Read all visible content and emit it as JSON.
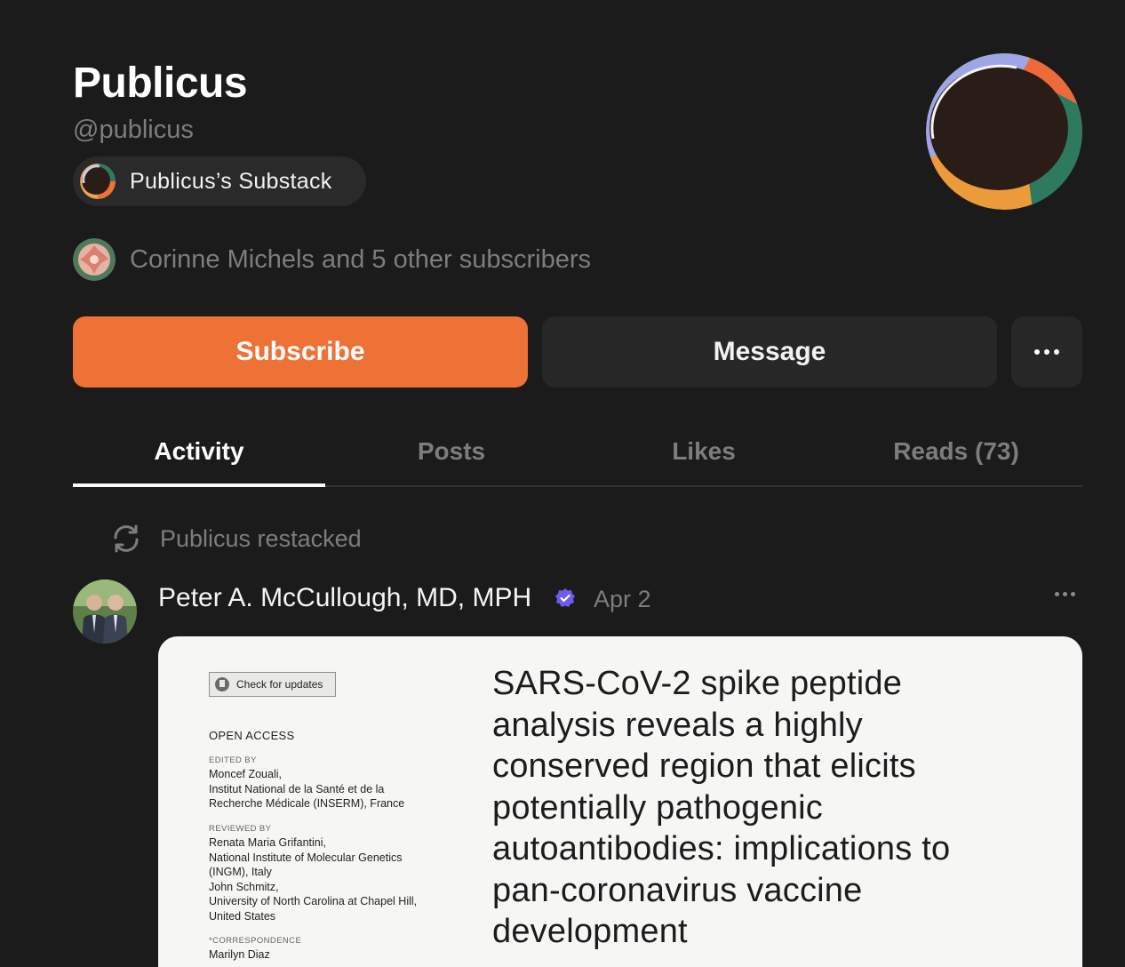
{
  "profile": {
    "name": "Publicus",
    "handle": "@publicus",
    "publication_label": "Publicus’s Substack",
    "subscribers_text": "Corinne Michels and 5 other subscribers"
  },
  "actions": {
    "subscribe_label": "Subscribe",
    "message_label": "Message",
    "more_icon": "ellipsis-icon"
  },
  "tabs": [
    {
      "label": "Activity",
      "active": true
    },
    {
      "label": "Posts",
      "active": false
    },
    {
      "label": "Likes",
      "active": false
    },
    {
      "label": "Reads (73)",
      "active": false
    }
  ],
  "activity": {
    "restack_text": "Publicus restacked",
    "author": "Peter A. McCullough, MD, MPH",
    "date": "Apr 2",
    "verified": true
  },
  "paper": {
    "check_updates": "Check for updates",
    "open_access": "OPEN ACCESS",
    "edited_by_caption": "EDITED BY",
    "edited_by": [
      "Moncef Zouali,",
      "Institut National de la Santé et de la",
      "Recherche Médicale (INSERM), France"
    ],
    "reviewed_by_caption": "REVIEWED BY",
    "reviewed_by": [
      "Renata Maria Grifantini,",
      "National Institute of Molecular Genetics",
      "(INGM), Italy",
      "John Schmitz,",
      "University of North Carolina at Chapel Hill,",
      "United States"
    ],
    "correspondence_caption": "*CORRESPONDENCE",
    "correspondence": [
      "Marilyn Diaz"
    ],
    "title": "SARS-CoV-2 spike peptide analysis reveals a highly conserved region that elicits potentially pathogenic autoantibodies: implications to pan-coronavirus vaccine development"
  },
  "colors": {
    "background": "#1b1b1c",
    "accent": "#ee7136",
    "muted_text": "#7d7d80",
    "button_dark": "#272728",
    "verified": "#6b5cf0"
  }
}
